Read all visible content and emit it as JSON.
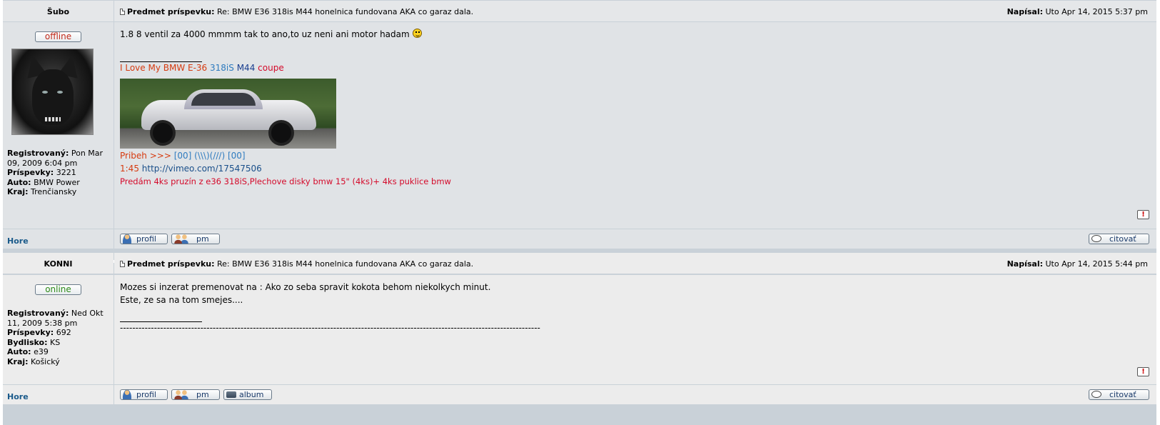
{
  "posts": [
    {
      "username": "Šubo",
      "status": "offline",
      "subject_label": "Predmet príspevku:",
      "subject": "Re: BMW E36 318is M44 honelnica fundovana AKA co garaz dala.",
      "posted_label": "Napísal:",
      "posted": "Uto Apr 14, 2015 5:37 pm",
      "profile": {
        "registered_label": "Registrovaný:",
        "registered": "Pon Mar 09, 2009 6:04 pm",
        "posts_label": "Príspevky:",
        "posts": "3221",
        "car_label": "Auto:",
        "car": "BMW Power",
        "region_label": "Kraj:",
        "region": "Trenčiansky"
      },
      "message": "1.8 8 ventil za 4000 mmmm tak to ano,to uz neni ani motor hadam",
      "signature": {
        "line1_part1": "I Love My BMW E-36",
        "line1_part2": "318iS",
        "line1_part3": "M44",
        "line1_part4": "coupe",
        "story_label": "Pribeh >>>",
        "story_links": "[00] (\\\\\\)(///) [00]",
        "video_time": "1:45",
        "video_link": "http://vimeo.com/17547506",
        "sale": "Predám 4ks pruzín z e36 318iS,Plechove disky bmw 15\" (4ks)+ 4ks puklice bmw"
      },
      "footer": {
        "top_link": "Hore",
        "profile_btn": "profil",
        "pm_btn": "pm",
        "quote_btn": "citovať"
      }
    },
    {
      "username": "KONNI",
      "status": "online",
      "subject_label": "Predmet príspevku:",
      "subject": "Re: BMW E36 318is M44 honelnica fundovana AKA co garaz dala.",
      "posted_label": "Napísal:",
      "posted": "Uto Apr 14, 2015 5:44 pm",
      "profile": {
        "registered_label": "Registrovaný:",
        "registered": "Ned Okt 11, 2009 5:38 pm",
        "posts_label": "Príspevky:",
        "posts": "692",
        "residence_label": "Bydlisko:",
        "residence": "KS",
        "car_label": "Auto:",
        "car": "e39",
        "region_label": "Kraj:",
        "region": "Košický"
      },
      "message_line1": "Mozes si inzerat premenovat na : Ako zo seba spravit kokota behom niekolkych minut.",
      "message_line2": "Este, ze sa na tom smejes....",
      "signature_dashes": "----------------------------------------------------------------------------------------------------------------------------------------",
      "footer": {
        "top_link": "Hore",
        "profile_btn": "profil",
        "pm_btn": "pm",
        "album_btn": "album",
        "quote_btn": "citovať"
      }
    }
  ],
  "report_symbol": "!"
}
